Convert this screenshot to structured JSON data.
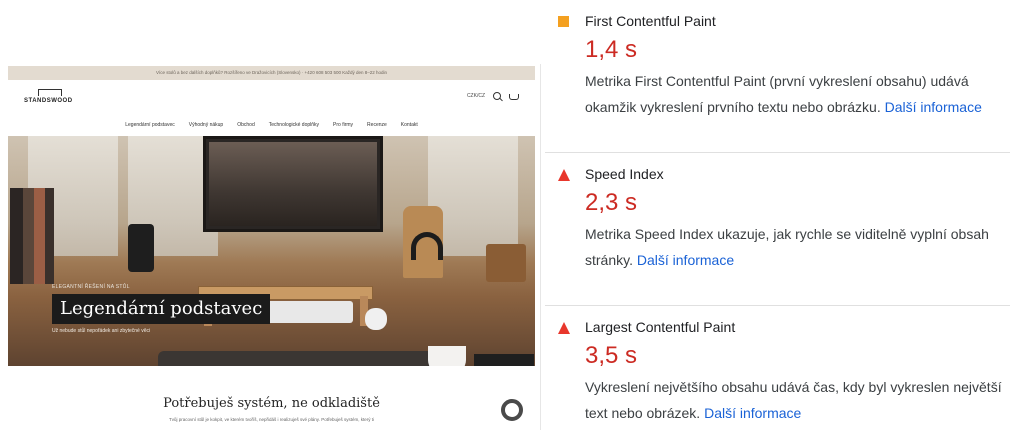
{
  "screenshot": {
    "topbar_text": "Více stolů a bez dalších doplňků? Rozšířeno ve Dražovicích (Slovensko) · +420 608 503 500 Každý den 8–22 hodin",
    "logo_text": "STANDSWOOD",
    "lang": "CZK/CZ",
    "nav": [
      "Legendární podstavec",
      "Výhodný nákup",
      "Obchod",
      "Technologické doplňky",
      "Pro firmy",
      "Recenze",
      "Kontakt"
    ],
    "hero": {
      "kicker": "ELEGANTNÍ ŘEŠENÍ NA STŮL",
      "title": "Legendární podstavec",
      "subtitle": "Už nebude stůl nepořádek ani zbytečné věci"
    },
    "section_title": "Potřebuješ systém, ne odkladiště",
    "section_sub": "Tvůj pracovní stůl je kokpit, ve kterém tvoříš, nepřidáš i realizuješ své plány. Potřebuješ systém, který ti"
  },
  "metrics": [
    {
      "title": "First Contentful Paint",
      "value": "1,4 s",
      "status": "average",
      "status_color": "#f4a020",
      "status_icon": "square-icon",
      "description": "Metrika First Contentful Paint (první vykreslení obsahu) udává okamžik vykreslení prvního textu nebo obrázku. ",
      "link": "Další informace"
    },
    {
      "title": "Speed Index",
      "value": "2,3 s",
      "status": "poor",
      "status_color": "#e8372c",
      "status_icon": "triangle-icon",
      "description": "Metrika Speed Index ukazuje, jak rychle se viditelně vyplní obsah stránky. ",
      "link": "Další informace"
    },
    {
      "title": "Largest Contentful Paint",
      "value": "3,5 s",
      "status": "poor",
      "status_color": "#e8372c",
      "status_icon": "triangle-icon",
      "description": "Vykreslení největšího obsahu udává čas, kdy byl vykreslen největší text nebo obrázek. ",
      "link": "Další informace"
    }
  ],
  "colors": {
    "value_red": "#cc2b23",
    "link_blue": "#1a62d6",
    "divider": "#e0e0e0"
  }
}
